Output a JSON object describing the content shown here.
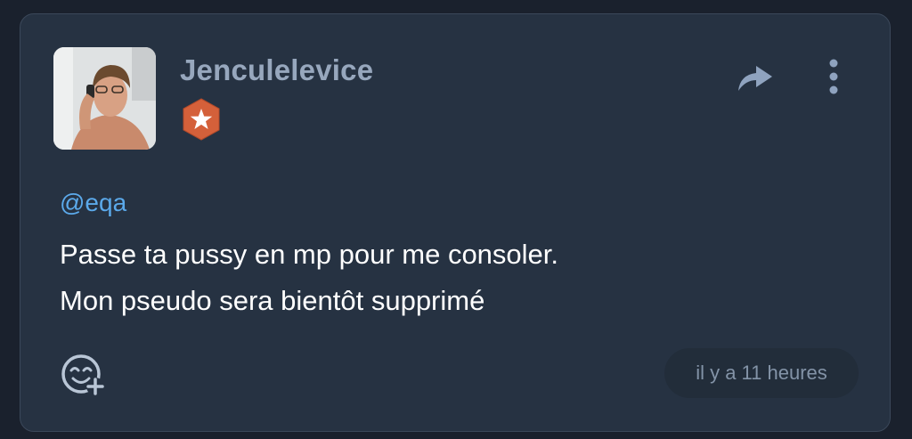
{
  "post": {
    "username": "Jenculelevice",
    "mention": "@eqa",
    "message_lines": [
      "Passe ta pussy en mp pour me consoler.",
      "Mon pseudo sera bientôt supprimé"
    ],
    "timestamp": "il y a 11 heures"
  },
  "icons": {
    "badge": "star-badge-icon",
    "share": "share-arrow-icon",
    "more": "more-vertical-icon",
    "react": "add-reaction-icon"
  },
  "colors": {
    "page_bg": "#1a212d",
    "card_bg": "#263242",
    "username": "#97a7bd",
    "mention": "#5ba9ea",
    "badge": "#d4603a",
    "timestamp_bg": "#222d3a"
  }
}
